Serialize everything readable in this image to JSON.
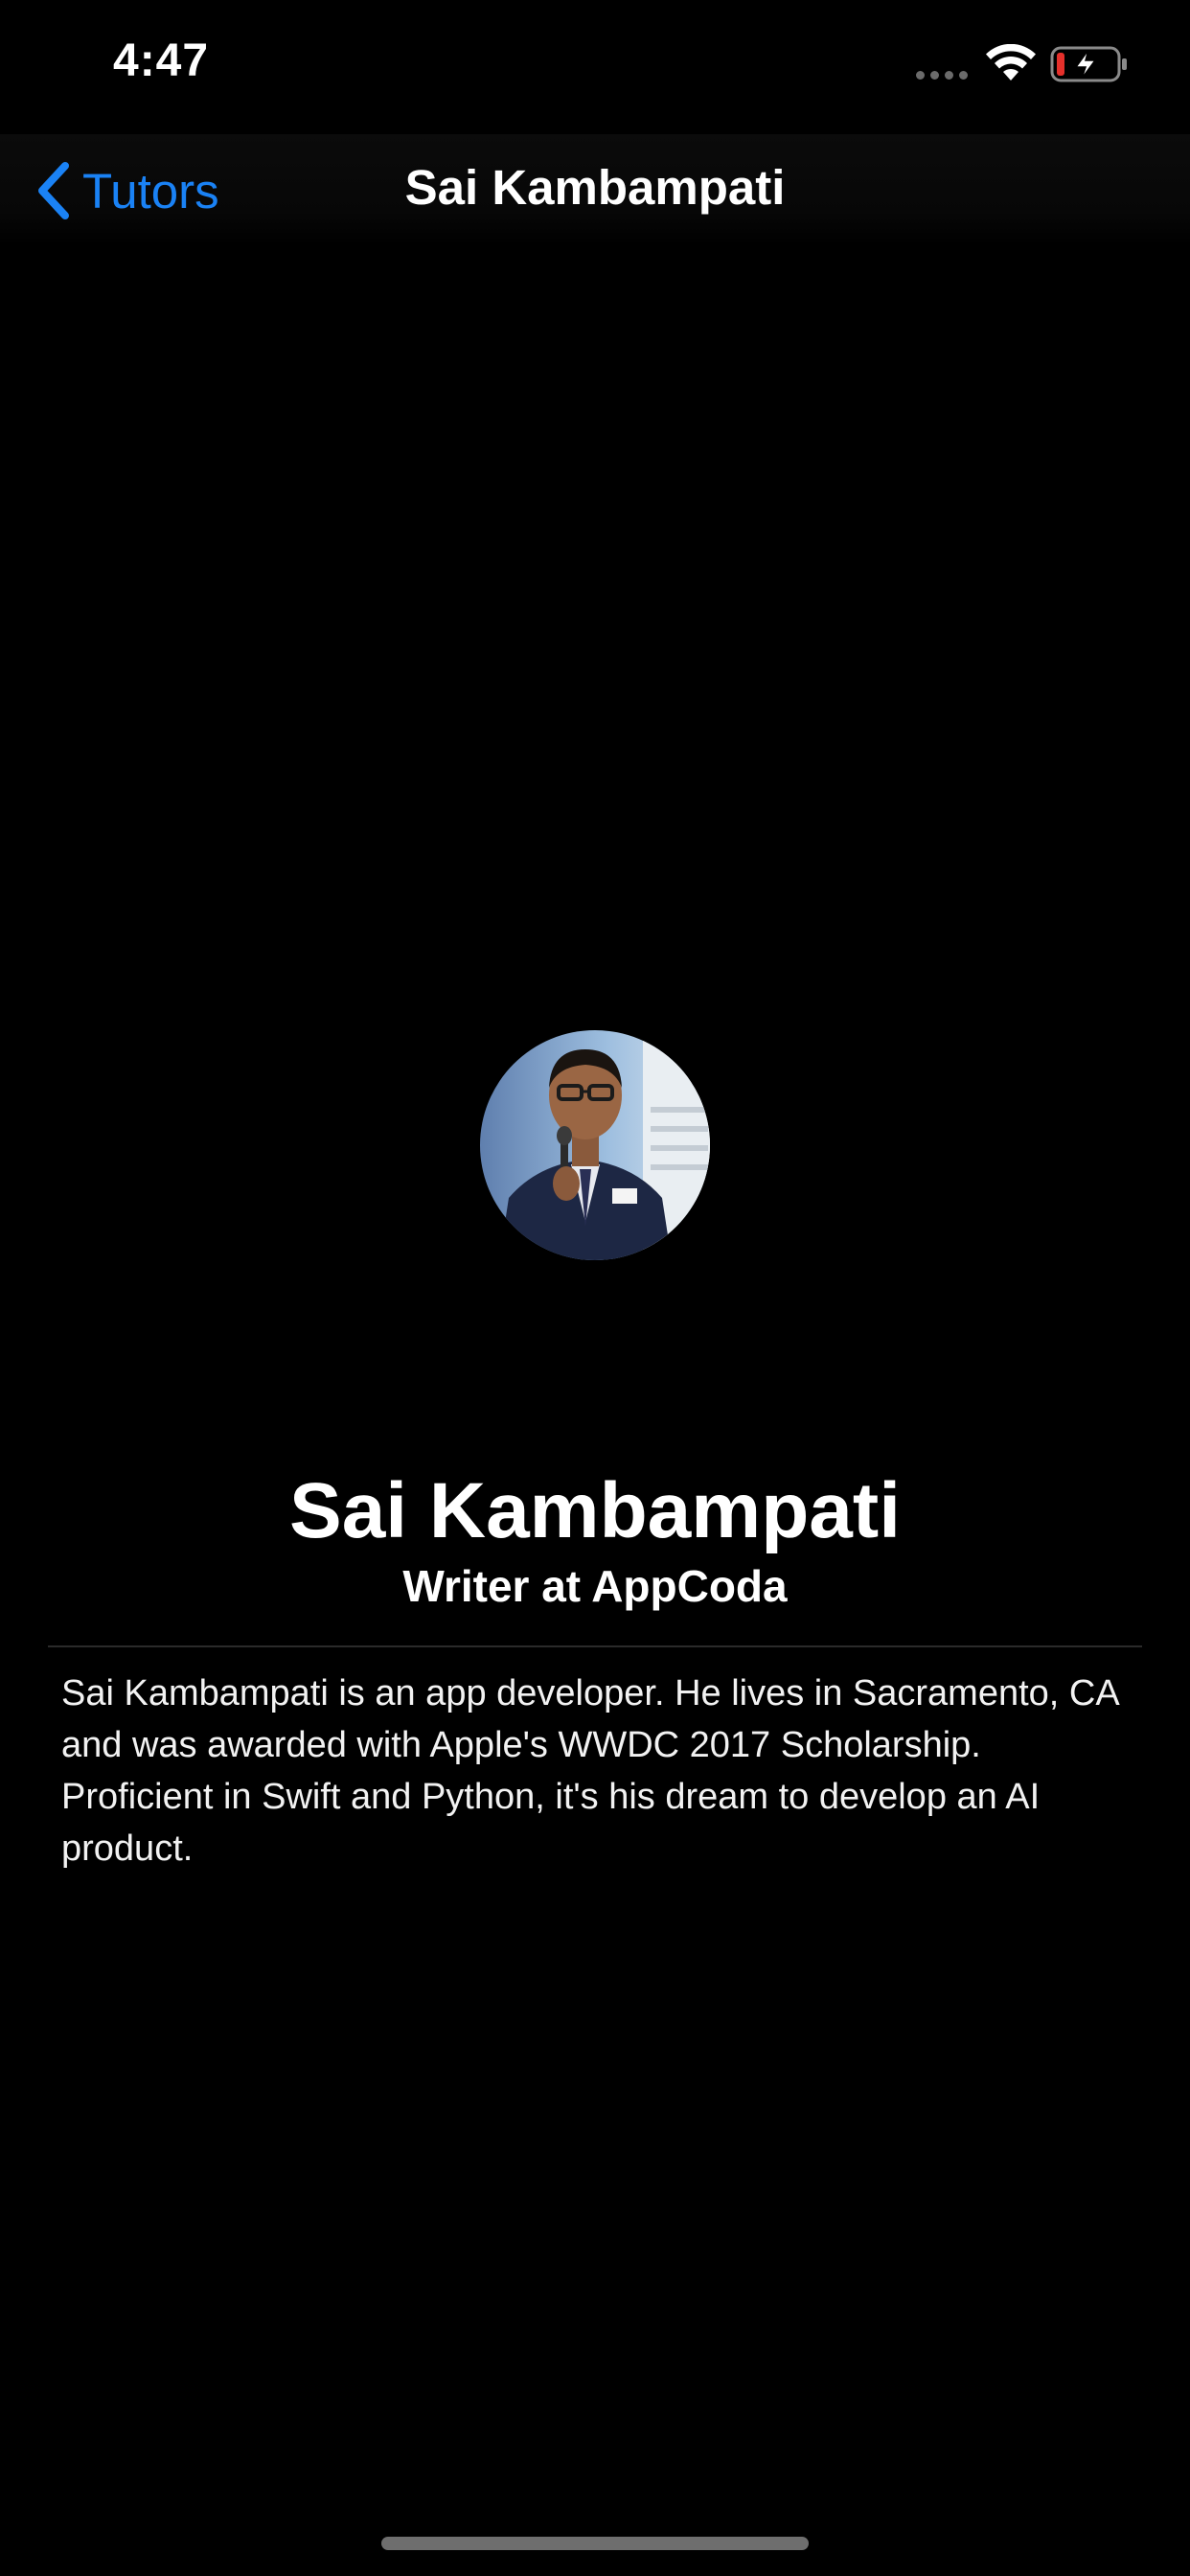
{
  "status_bar": {
    "time": "4:47",
    "icons": [
      "cellular-signal-icon",
      "wifi-icon",
      "battery-charging-icon"
    ]
  },
  "nav": {
    "back_label": "Tutors",
    "back_icon": "chevron-left-icon",
    "title": "Sai Kambampati"
  },
  "profile": {
    "name": "Sai Kambampati",
    "headline": "Writer at AppCoda",
    "bio": "Sai Kambampati is an app developer. He lives in Sacramento, CA and was awarded with Apple's WWDC 2017 Scholarship. Proficient in Swift and Python, it's his dream to develop an AI product."
  },
  "colors": {
    "background": "#000000",
    "accent": "#1a82f5",
    "battery_low": "#e5302b"
  }
}
